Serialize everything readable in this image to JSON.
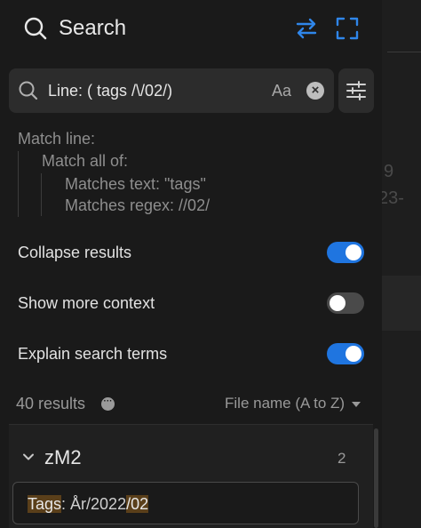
{
  "header": {
    "title": "Search",
    "icons": [
      "search-icon",
      "swap-icon",
      "expand-icon"
    ]
  },
  "search": {
    "value": "Line: ( tags /\\/02/)",
    "case_label": "Aa",
    "clear_label": "×"
  },
  "explanation": {
    "match_line": "Match line:",
    "match_all": "Match all of:",
    "text_rule": "Matches text: \"tags\"",
    "regex_rule": "Matches regex: //02/"
  },
  "settings": {
    "collapse": {
      "label": "Collapse results",
      "on": true
    },
    "context": {
      "label": "Show more context",
      "on": false
    },
    "explain": {
      "label": "Explain search terms",
      "on": true
    }
  },
  "results": {
    "count_label": "40 results",
    "more_label": "···",
    "sort_label": "File name (A to Z)"
  },
  "file": {
    "name": "zM2",
    "count": "2",
    "match": {
      "part1": "Tags",
      "part2": ": År/2022",
      "part3": "/02"
    }
  },
  "background": {
    "frag1": "9",
    "frag2": "23-"
  },
  "colors": {
    "accent": "#1f75e0",
    "highlight": "#5a3f1a",
    "panel": "#1a1a1a"
  }
}
